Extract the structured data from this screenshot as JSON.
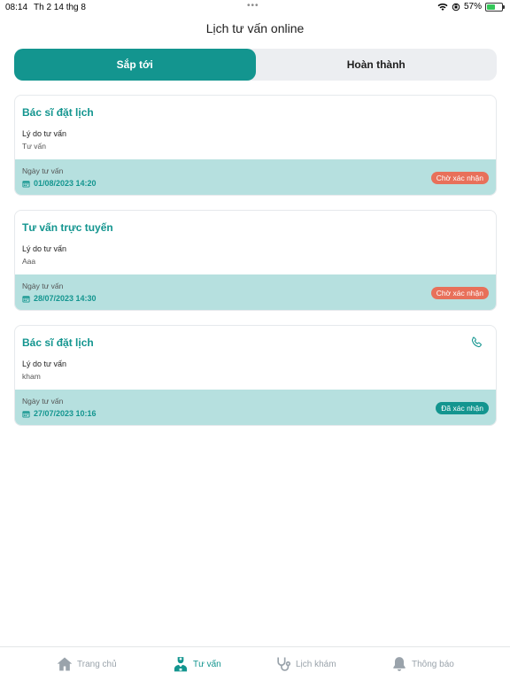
{
  "status": {
    "time": "08:14",
    "date": "Th 2 14 thg 8",
    "battery": "57%",
    "battery_level": 0.57
  },
  "header": {
    "title": "Lịch tư vấn online"
  },
  "tabs": [
    {
      "label": "Sắp tới",
      "active": true
    },
    {
      "label": "Hoàn thành",
      "active": false
    }
  ],
  "appointments": [
    {
      "title": "Bác sĩ đặt lịch",
      "reason_label": "Lý do tư vấn",
      "reason": "Tư vấn",
      "date_label": "Ngày tư vấn",
      "date": "01/08/2023 14:20",
      "status": "Chờ xác nhận",
      "status_color": "#e8705a",
      "has_phone": false
    },
    {
      "title": "Tư vấn trực tuyến",
      "reason_label": "Lý do tư vấn",
      "reason": "Aaa",
      "date_label": "Ngày tư vấn",
      "date": "28/07/2023 14:30",
      "status": "Chờ xác nhận",
      "status_color": "#e8705a",
      "has_phone": false
    },
    {
      "title": "Bác sĩ đặt lịch",
      "reason_label": "Lý do tư vấn",
      "reason": "kham",
      "date_label": "Ngày tư vấn",
      "date": "27/07/2023 10:16",
      "status": "Đã xác nhận",
      "status_color": "#13958f",
      "has_phone": true
    }
  ],
  "bottom_nav": [
    {
      "label": "Trang chủ",
      "icon": "home-icon",
      "active": false
    },
    {
      "label": "Tư vấn",
      "icon": "doctor-icon",
      "active": true
    },
    {
      "label": "Lịch khám",
      "icon": "stethoscope-icon",
      "active": false
    },
    {
      "label": "Thông báo",
      "icon": "bell-icon",
      "active": false
    }
  ],
  "colors": {
    "accent": "#13958f",
    "card_footer": "#b6e0df",
    "pending": "#e8705a"
  }
}
